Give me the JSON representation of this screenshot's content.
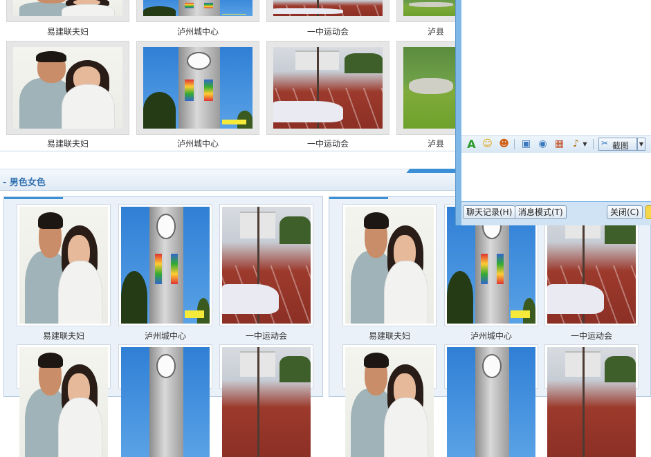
{
  "captions": {
    "couple": "易建联夫妇",
    "tower": "泸州城中心",
    "track": "一中运动会",
    "lake": "泸县"
  },
  "section": {
    "title": "- 男色女色"
  },
  "chat": {
    "toolbar": {
      "font_icon": "A",
      "emoji_icon": "☺",
      "screenshot_label": "截图"
    },
    "buttons": {
      "history": "聊天记录(H)",
      "mode": "消息模式(T)",
      "close": "关闭(C)"
    }
  },
  "colors": {
    "section_title": "#2f6fae",
    "chat_frame": "#7fb7e6"
  }
}
